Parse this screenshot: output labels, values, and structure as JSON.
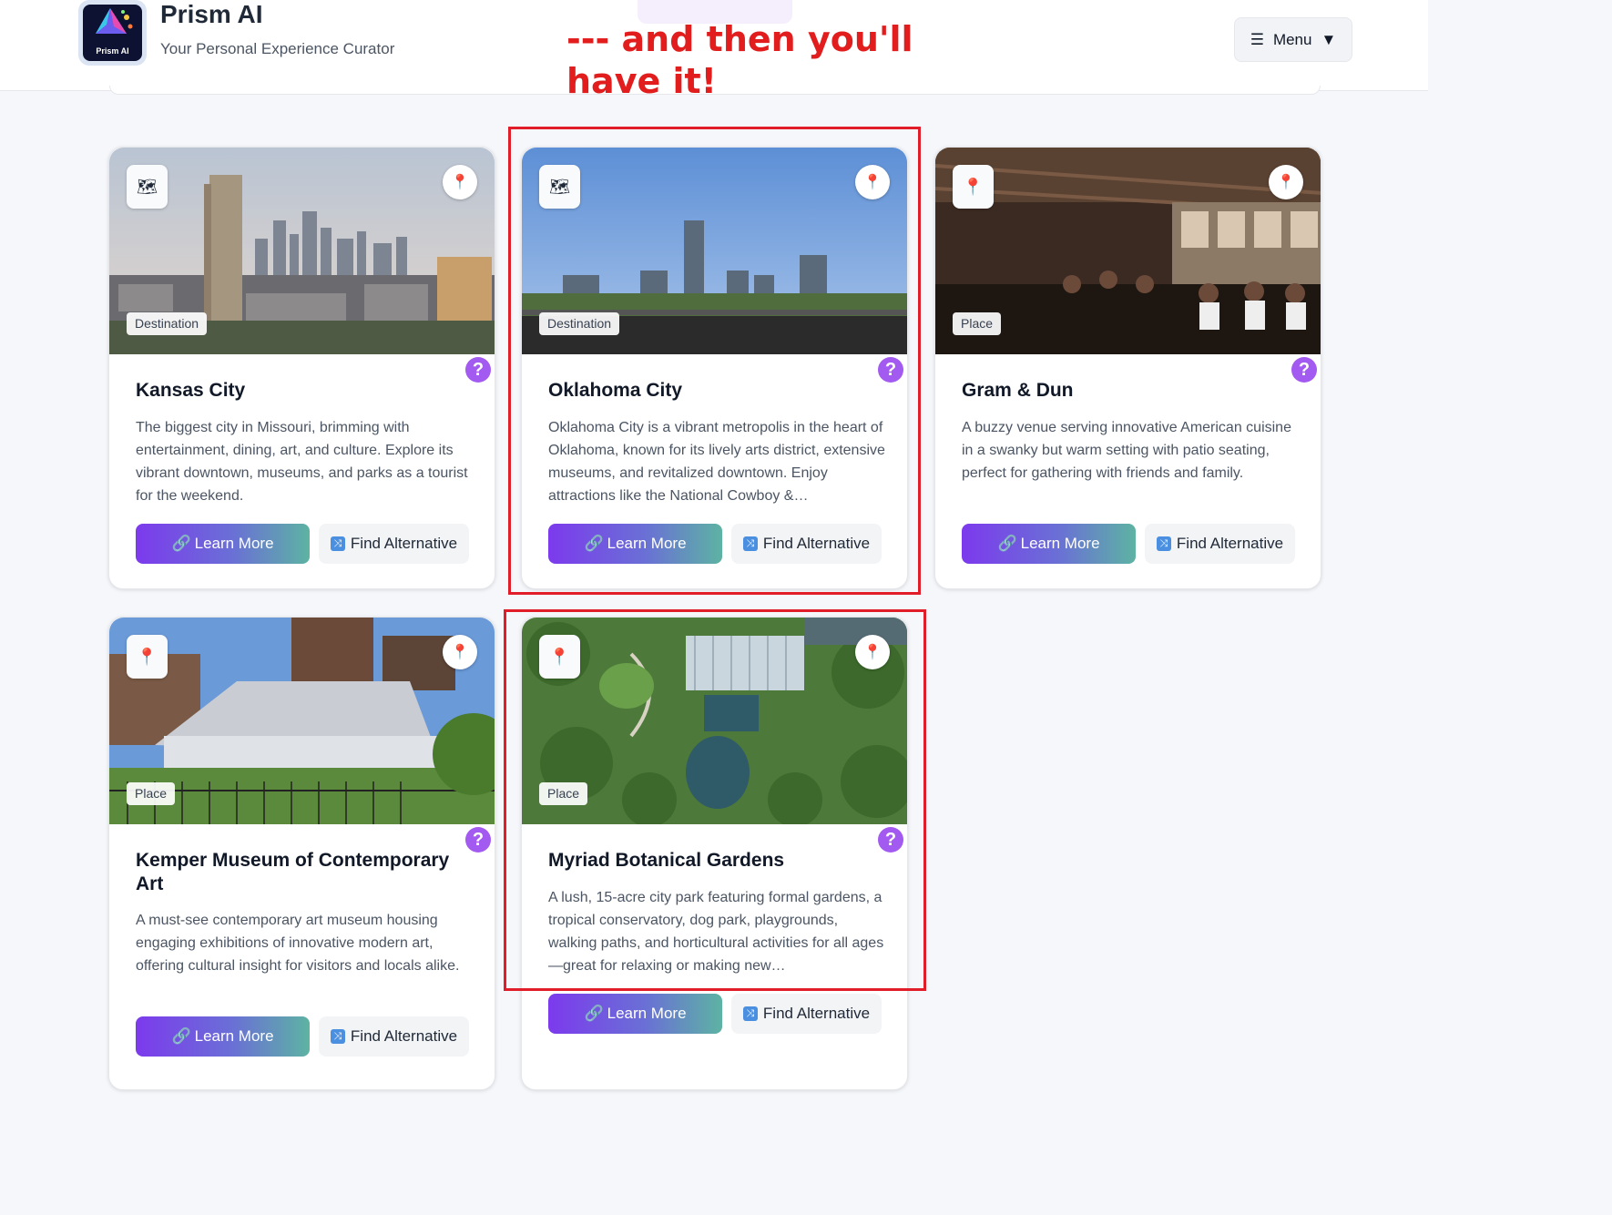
{
  "header": {
    "logo_text": "Prism AI",
    "title": "Prism AI",
    "subtitle": "Your Personal Experience Curator",
    "menu_label": "Menu",
    "menu_icon": "hamburger-icon",
    "menu_caret": "▼"
  },
  "annotation": {
    "text": "--- and then you'll have it!",
    "color": "#e11d1d"
  },
  "cards": [
    {
      "title": "Kansas City",
      "type": "Destination",
      "type_icon": "map-icon",
      "description": "The biggest city in Missouri, brimming with entertainment, dining, art, and culture. Explore its vibrant downtown, museums, and parks as a tourist for the weekend.",
      "learn_more": "Learn More",
      "find_alternative": "Find Alternative"
    },
    {
      "title": "Oklahoma City",
      "type": "Destination",
      "type_icon": "map-icon",
      "description": "Oklahoma City is a vibrant metropolis in the heart of Oklahoma, known for its lively arts district, extensive museums, and revitalized downtown. Enjoy attractions like the National Cowboy &…",
      "learn_more": "Learn More",
      "find_alternative": "Find Alternative"
    },
    {
      "title": "Gram & Dun",
      "type": "Place",
      "type_icon": "pin-icon",
      "description": "A buzzy venue serving innovative American cuisine in a swanky but warm setting with patio seating, perfect for gathering with friends and family.",
      "learn_more": "Learn More",
      "find_alternative": "Find Alternative"
    },
    {
      "title": "Kemper Museum of Contemporary Art",
      "type": "Place",
      "type_icon": "pin-icon",
      "description": "A must-see contemporary art museum housing engaging exhibitions of innovative modern art, offering cultural insight for visitors and locals alike.",
      "learn_more": "Learn More",
      "find_alternative": "Find Alternative"
    },
    {
      "title": "Myriad Botanical Gardens",
      "type": "Place",
      "type_icon": "pin-icon",
      "description": "A lush, 15-acre city park featuring formal gardens, a tropical conservatory, dog park, playgrounds, walking paths, and horticultural activities for all ages—great for relaxing or making new…",
      "learn_more": "Learn More",
      "find_alternative": "Find Alternative"
    }
  ],
  "colors": {
    "accent_purple": "#7c3aed",
    "accent_teal": "#5db3a3",
    "help_purple": "#a35af0",
    "highlight_red": "#e11d2a"
  }
}
